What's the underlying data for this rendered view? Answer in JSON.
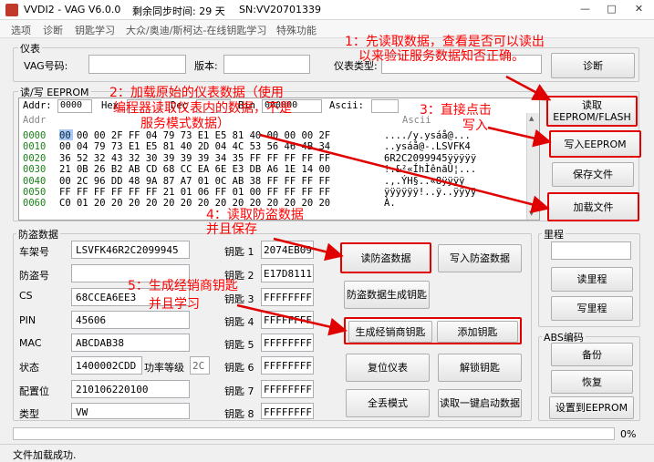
{
  "window": {
    "title": "VVDI2 - VAG V6.0.0",
    "remaining_days": "剩余同步时间: 29 天",
    "serial": "SN:VV20701339",
    "minimize": "—",
    "maximize": "□",
    "close": "✕"
  },
  "menu": [
    "选项",
    "诊断",
    "钥匙学习",
    "大众/奥迪/斯柯达-在线钥匙学习",
    "特殊功能"
  ],
  "instrument": {
    "group_label": "仪表",
    "vag_label": "VAG号码:",
    "vag_value": "",
    "version_label": "版本:",
    "version_value": "",
    "type_label": "仪表类型:",
    "type_value": "",
    "diagnose_button": "诊断"
  },
  "eeprom": {
    "group_label": "读/写 EEPROM",
    "addr_label": "Addr:",
    "addr_value": "0000",
    "hex_label": "Hex",
    "hex_value": "",
    "dec_label": "Dec",
    "dec_value": "",
    "bin_label": "Bin",
    "bin_value": "000000",
    "ascii_label": "Ascii:",
    "ascii_value": "",
    "col_header_addr": "Addr",
    "col_header_ascii": "Ascii",
    "rows": [
      {
        "addr": "0000",
        "hex": "00 00 00 2F FF 04 79 73 E1 E5 81 40 00 00 00 2F",
        "ascii": "..../y.ysáå@..."
      },
      {
        "addr": "0010",
        "hex": "00 04 79 73 E1 E5 81 40 2D 04 4C 53 56 46 4B 34",
        "ascii": "..ysáå@-.LSVFK4"
      },
      {
        "addr": "0020",
        "hex": "36 52 32 43 32 30 39 39 39 34 35 FF FF FF FF FF",
        "ascii": "6R2C2099945ÿÿÿÿÿ"
      },
      {
        "addr": "0030",
        "hex": "21 0B 26 B2 AB CD 68 CC EA 6E E3 DB A6 1E 14 00",
        "ascii": "!.&²«ÍhÌênãÛ¦..."
      },
      {
        "addr": "0040",
        "hex": "00 2C 96 DD 48 9A 87 A7 01 0C AB 38 FF FF FF FF",
        "ascii": ".,.ÝH§..«8ÿÿÿÿ"
      },
      {
        "addr": "0050",
        "hex": "FF FF FF FF FF FF 21 01 06 FF 01 00 FF FF FF FF",
        "ascii": "ÿÿÿÿÿÿ!..ÿ..ÿÿÿÿ"
      },
      {
        "addr": "0060",
        "hex": "C0 01 20 20 20 20 20 20 20 20 20 20 20 20 20 20",
        "ascii": "À."
      }
    ],
    "read_button": "读取\nEEPROM/FLASH",
    "write_button": "写入EEPROM",
    "save_button": "保存文件",
    "load_button": "加载文件"
  },
  "immo": {
    "group_label": "防盗数据",
    "fields": [
      {
        "label": "车架号",
        "value": "LSVFK46R2C2099945"
      },
      {
        "label": "防盗号",
        "value": ""
      },
      {
        "label": "CS",
        "value": "68CCEA6EE3"
      },
      {
        "label": "PIN",
        "value": "45606"
      },
      {
        "label": "MAC",
        "value": "ABCDAB38"
      },
      {
        "label": "状态",
        "value": "1400002CDD"
      },
      {
        "label": "配置位",
        "value": "210106220100"
      },
      {
        "label": "类型",
        "value": "VW"
      }
    ],
    "power_label": "功率等级",
    "power_value": "2C",
    "keys": [
      {
        "label": "钥匙 1",
        "value": "2074EB09"
      },
      {
        "label": "钥匙 2",
        "value": "E17D8111"
      },
      {
        "label": "钥匙 3",
        "value": "FFFFFFFF"
      },
      {
        "label": "钥匙 4",
        "value": "FFFFFFFF"
      },
      {
        "label": "钥匙 5",
        "value": "FFFFFFFF"
      },
      {
        "label": "钥匙 6",
        "value": "FFFFFFFF"
      },
      {
        "label": "钥匙 7",
        "value": "FFFFFFFF"
      },
      {
        "label": "钥匙 8",
        "value": "FFFFFFFF"
      }
    ],
    "buttons": {
      "read_immo": "读防盗数据",
      "write_immo": "写入防盗数据",
      "gen_key_from_immo": "防盗数据生成钥匙",
      "gen_dealer_key": "生成经销商钥匙",
      "add_key": "添加钥匙",
      "reset_instrument": "复位仪表",
      "unlock_key": "解锁钥匙",
      "all_keys_lost": "全丢模式",
      "read_one_key_start": "读取一键启动数据"
    }
  },
  "mileage": {
    "group_label": "里程",
    "value": "",
    "read_button": "读里程",
    "write_button": "写里程"
  },
  "abs": {
    "group_label": "ABS编码",
    "backup_button": "备份",
    "restore_button": "恢复",
    "set_eeprom_button": "设置到EEPROM"
  },
  "progress": {
    "percent": 0,
    "label": "0%"
  },
  "status": {
    "text": "文件加载成功."
  },
  "annotations": {
    "step1_line1": "1：先读取数据，查看是否可以读出",
    "step1_line2": "以来验证服务数据知否正确。",
    "step2_line1": "2：加载原始的仪表数据（使用",
    "step2_line2": "编程器读取仪表内的数据，不是",
    "step2_line3": "服务模式数据）",
    "step3_line1": "3：直接点击",
    "step3_line2": "写入",
    "step4_line1": "4：读取防盗数据",
    "step4_line2": "并且保存",
    "step5_line1": "5：生成经销商钥匙",
    "step5_line2": "并且学习",
    "color": "#ff0000"
  }
}
